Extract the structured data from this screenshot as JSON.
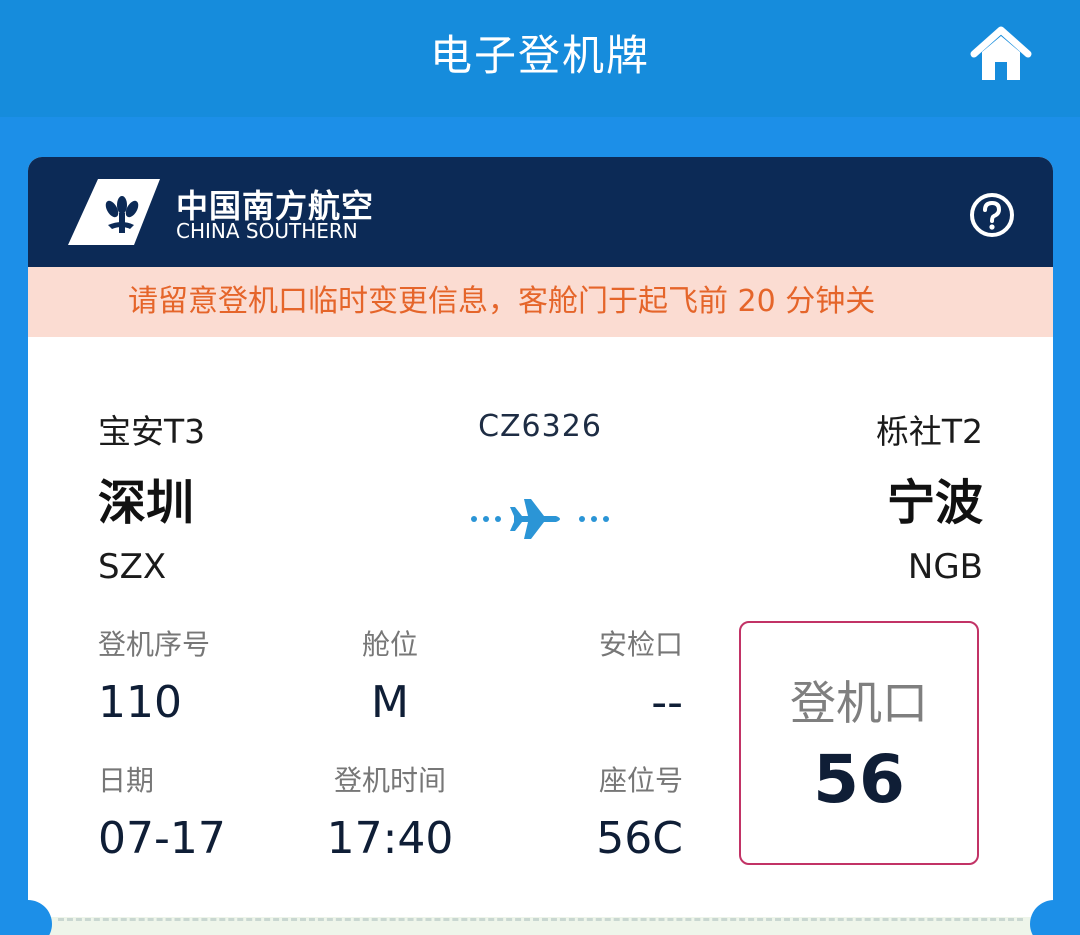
{
  "app": {
    "title": "电子登机牌",
    "home_icon": "home-icon"
  },
  "airline": {
    "name_cn": "中国南方航空",
    "name_en": "CHINA SOUTHERN",
    "logo_icon": "kapok-logo-icon",
    "help_icon": "help-circle-icon"
  },
  "notice": {
    "text": "请留意登机口临时变更信息，客舱门于起飞前 20 分钟关"
  },
  "flight": {
    "number": "CZ6326",
    "origin": {
      "terminal": "宝安T3",
      "city": "深圳",
      "code": "SZX"
    },
    "destination": {
      "terminal": "栎社T2",
      "city": "宁波",
      "code": "NGB"
    }
  },
  "details": {
    "boarding_seq_label": "登机序号",
    "boarding_seq": "110",
    "cabin_label": "舱位",
    "cabin": "M",
    "security_label": "安检口",
    "security": "--",
    "date_label": "日期",
    "date": "07-17",
    "boarding_time_label": "登机时间",
    "boarding_time": "17:40",
    "seat_label": "座位号",
    "seat": "56C"
  },
  "gate": {
    "label": "登机口",
    "value": "56"
  },
  "colors": {
    "header_blue": "#168cdc",
    "card_navy": "#0c2a56",
    "notice_bg": "#fbdcd2",
    "notice_text": "#e5652a",
    "gate_border": "#c23366",
    "plane_blue": "#2b95d6"
  }
}
